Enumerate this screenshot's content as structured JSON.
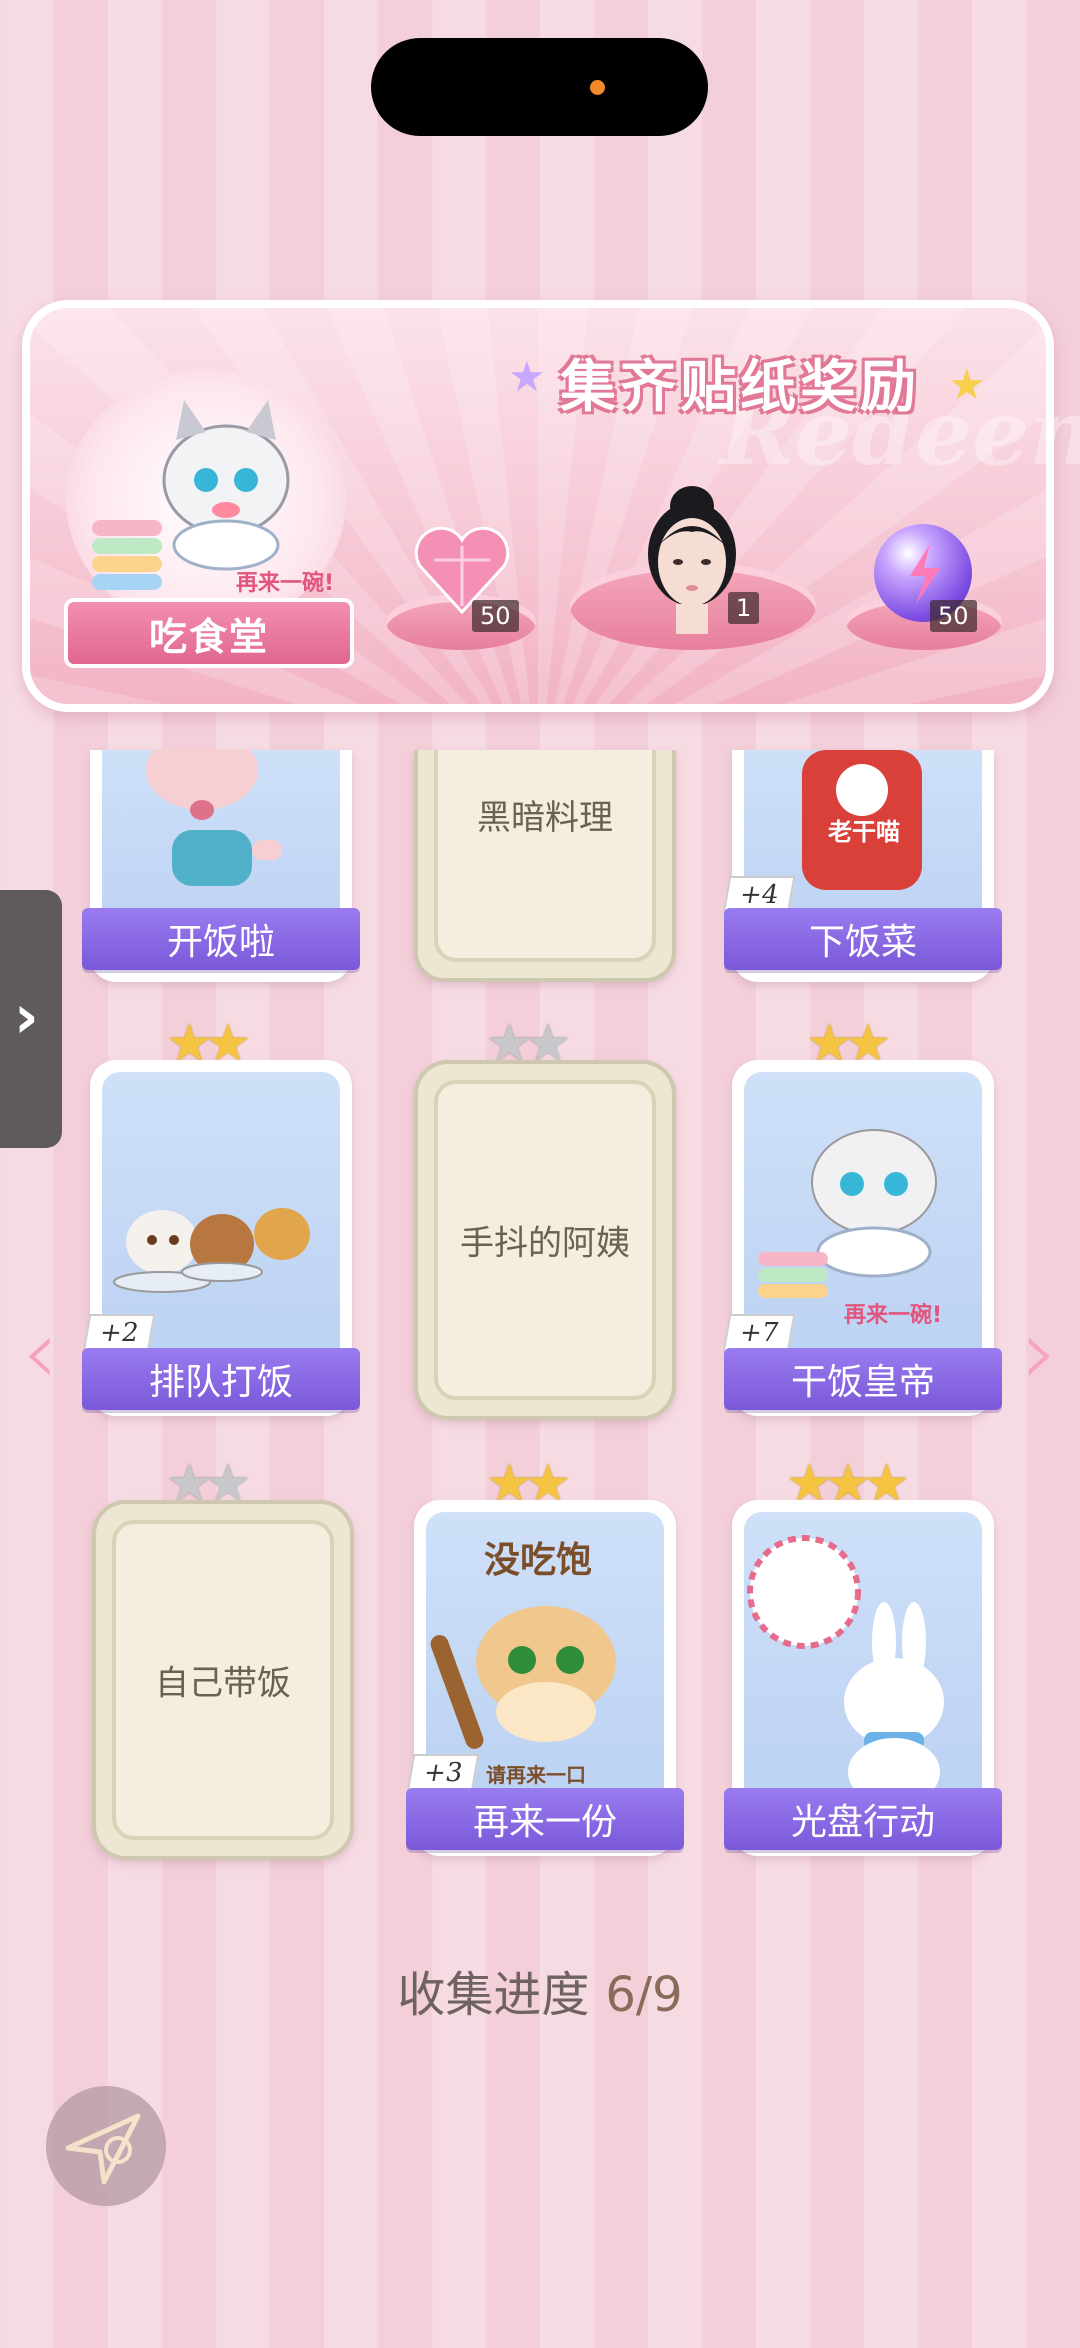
{
  "banner": {
    "title": "集齐贴纸奖励",
    "watermark": "Redeem",
    "canteen_label": "吃食堂",
    "cat_caption": "再来一碗!",
    "rewards": [
      {
        "icon": "pink-heart-gem-icon",
        "count": "50"
      },
      {
        "icon": "character-avatar",
        "count": "1"
      },
      {
        "icon": "purple-energy-orb-icon",
        "count": "50"
      }
    ]
  },
  "cards": [
    {
      "name": "开饭啦",
      "collected": true,
      "stars": 0
    },
    {
      "name": "黑暗料理",
      "collected": false,
      "stars": 0
    },
    {
      "name": "下饭菜",
      "collected": true,
      "plus": "+4",
      "bottle_label": "老干喵"
    },
    {
      "name": "排队打饭",
      "collected": true,
      "plus": "+2",
      "stars_gold": 2,
      "stars_total": 2
    },
    {
      "name": "手抖的阿姨",
      "collected": false,
      "stars_gold": 0,
      "stars_total": 2
    },
    {
      "name": "干饭皇帝",
      "collected": true,
      "plus": "+7",
      "stars_gold": 2,
      "stars_total": 2,
      "caption": "再来一碗!"
    },
    {
      "name": "自己带饭",
      "collected": false,
      "stars_gold": 0,
      "stars_total": 2
    },
    {
      "name": "再来一份",
      "collected": true,
      "plus": "+3",
      "stars_gold": 2,
      "stars_total": 2,
      "top_text": "没吃饱",
      "bottom_text": "请再来一口"
    },
    {
      "name": "光盘行动",
      "collected": true,
      "stars_gold": 3,
      "stars_total": 3
    }
  ],
  "progress": {
    "label": "收集进度",
    "value": "6/9"
  },
  "colors": {
    "ribbon": "#7a58d8",
    "banner_pink": "#f2b4c5",
    "background_stripe": "#f7dbe3"
  }
}
